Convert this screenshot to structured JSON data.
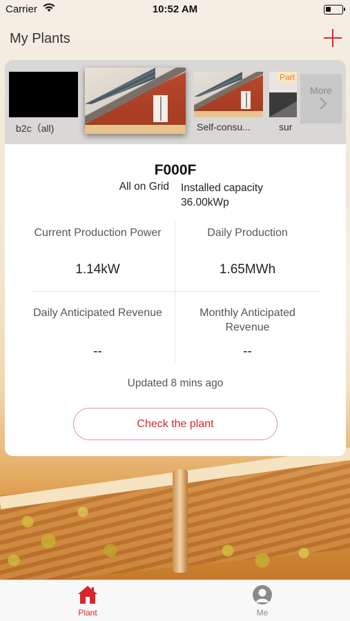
{
  "status_bar": {
    "carrier": "Carrier",
    "time": "10:52 AM"
  },
  "header": {
    "title": "My Plants",
    "add_icon": "plus-icon"
  },
  "plants_carousel": {
    "items": [
      {
        "label": "b2c（all)"
      },
      {
        "label": "",
        "selected": true
      },
      {
        "label": "Self-consu..."
      },
      {
        "label": "sur",
        "badge": "Part"
      }
    ],
    "more_label": "More"
  },
  "plant_card": {
    "name": "F000F",
    "grid_type": "All on Grid",
    "capacity_label": "Installed capacity",
    "capacity_value": "36.00kWp",
    "metrics": [
      {
        "label": "Current Production Power",
        "value": "1.14kW"
      },
      {
        "label": "Daily Production",
        "value": "1.65MWh"
      },
      {
        "label": "Daily Anticipated Revenue",
        "value": "--"
      },
      {
        "label": "Monthly Anticipated Revenue",
        "value": "--"
      }
    ],
    "updated": "Updated 8 mins ago",
    "check_button": "Check the plant"
  },
  "tab_bar": {
    "tabs": [
      {
        "label": "Plant",
        "icon": "home-icon",
        "active": true
      },
      {
        "label": "Me",
        "icon": "person-icon",
        "active": false
      }
    ]
  },
  "colors": {
    "accent": "#d8262c",
    "inactive": "#8a8a8a"
  }
}
